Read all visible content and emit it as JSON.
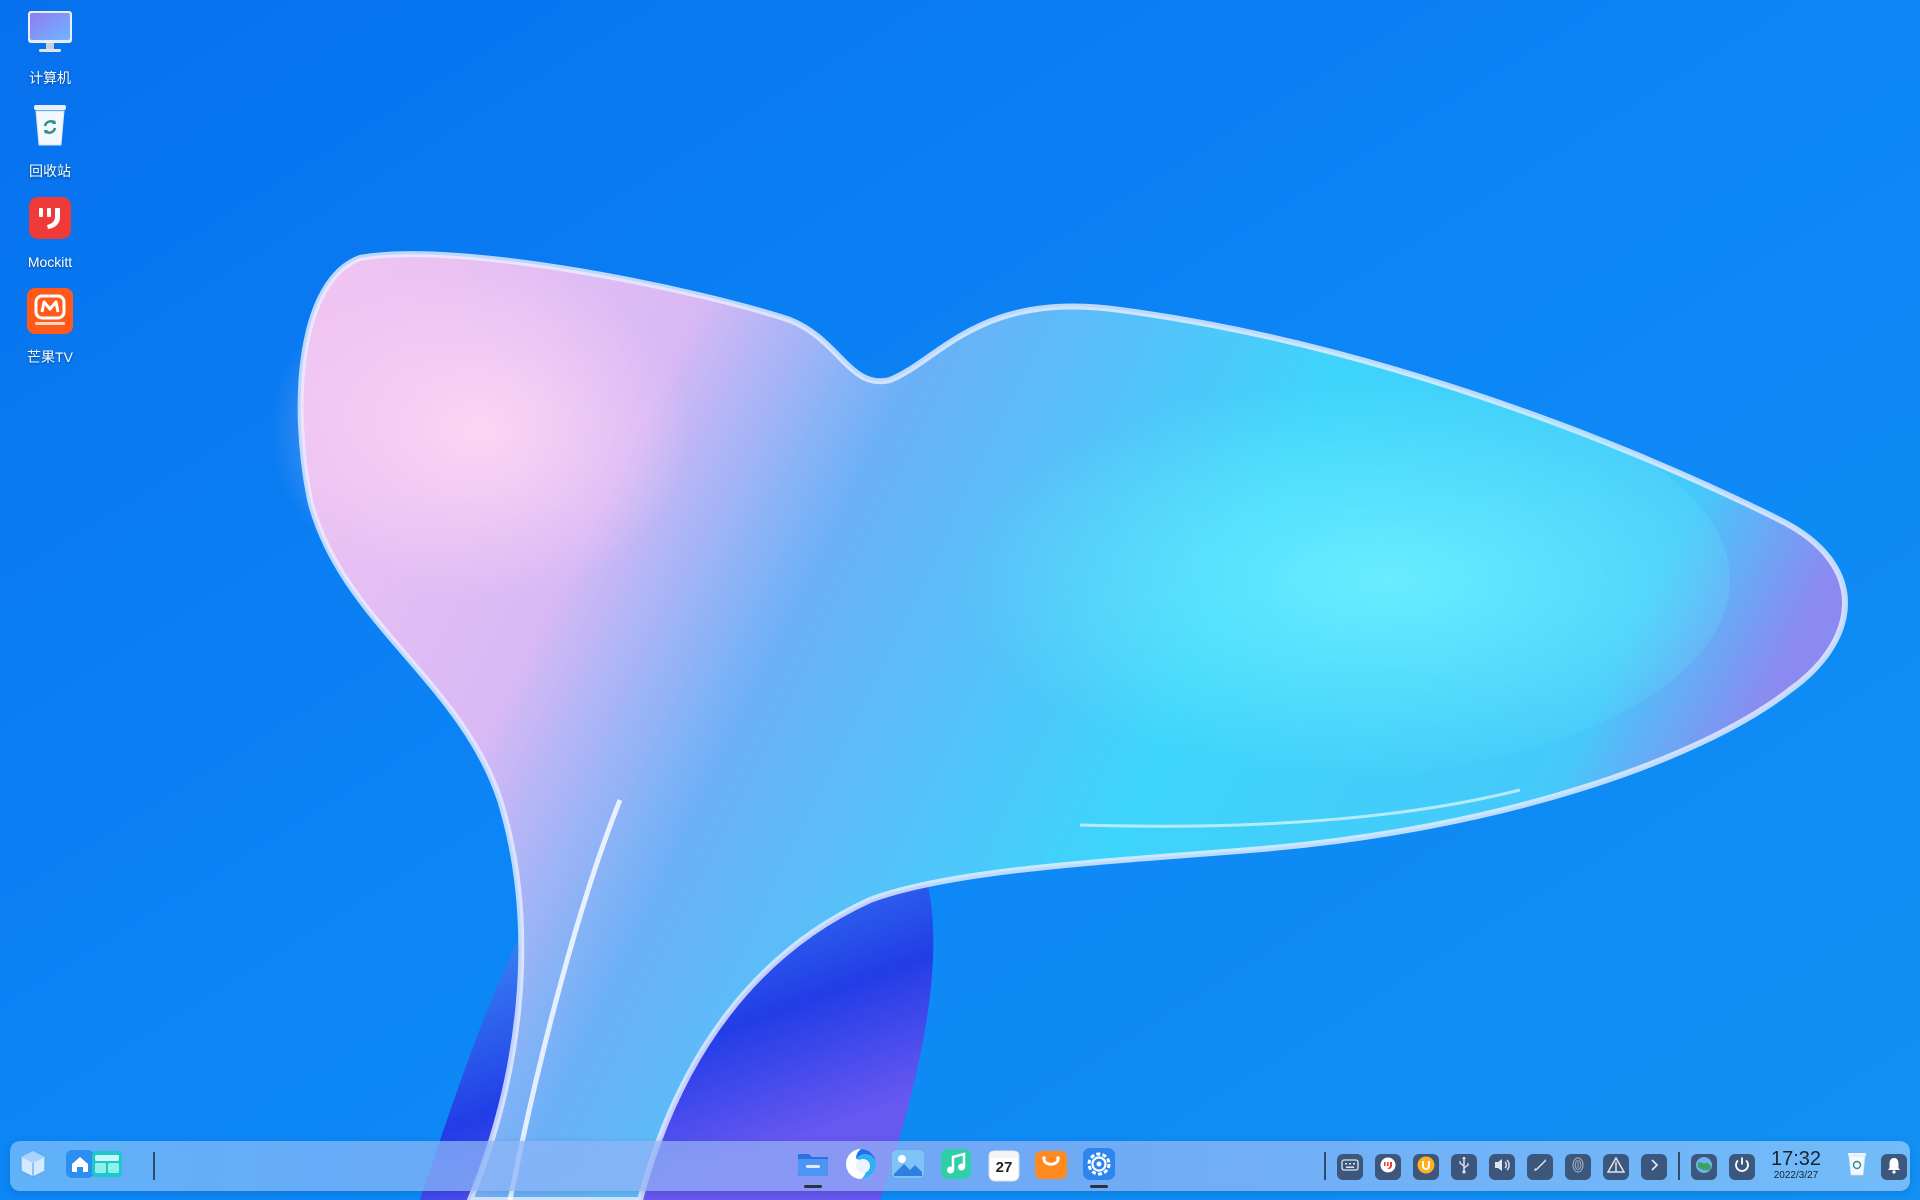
{
  "desktop": {
    "icons": [
      {
        "label": "计算机",
        "icon": "computer-icon"
      },
      {
        "label": "回收站",
        "icon": "trash-icon"
      },
      {
        "label": "Mockitt",
        "icon": "mockitt-app-icon"
      },
      {
        "label": "芒果TV",
        "icon": "mangotv-app-icon"
      }
    ]
  },
  "taskbar": {
    "left": [
      "start-menu-icon",
      "home-icon",
      "multitask-view-icon"
    ],
    "apps": [
      {
        "icon": "file-manager-icon",
        "running": true
      },
      {
        "icon": "browser-icon",
        "running": false
      },
      {
        "icon": "image-viewer-icon",
        "running": false
      },
      {
        "icon": "music-player-icon",
        "running": false
      },
      {
        "icon": "calendar-icon",
        "running": false,
        "day": "27"
      },
      {
        "icon": "app-store-icon",
        "running": false
      },
      {
        "icon": "settings-icon",
        "running": true
      }
    ],
    "tray": [
      "keyboard-icon",
      "mockitt-tray-icon",
      "ukey-tray-icon",
      "usb-icon",
      "volume-icon",
      "pen-icon",
      "fingerprint-icon",
      "network-icon",
      "expand-arrow-icon",
      "globe-icon",
      "power-icon"
    ],
    "clock": {
      "time": "17:32",
      "date": "2022/3/27"
    },
    "right": [
      "trash-tray-icon",
      "notification-bell-icon"
    ]
  },
  "colors": {
    "wallpaper_blue": "#0d86f5",
    "mockitt_red": "#ef3a3a",
    "mango_orange": "#ff5a1a"
  }
}
